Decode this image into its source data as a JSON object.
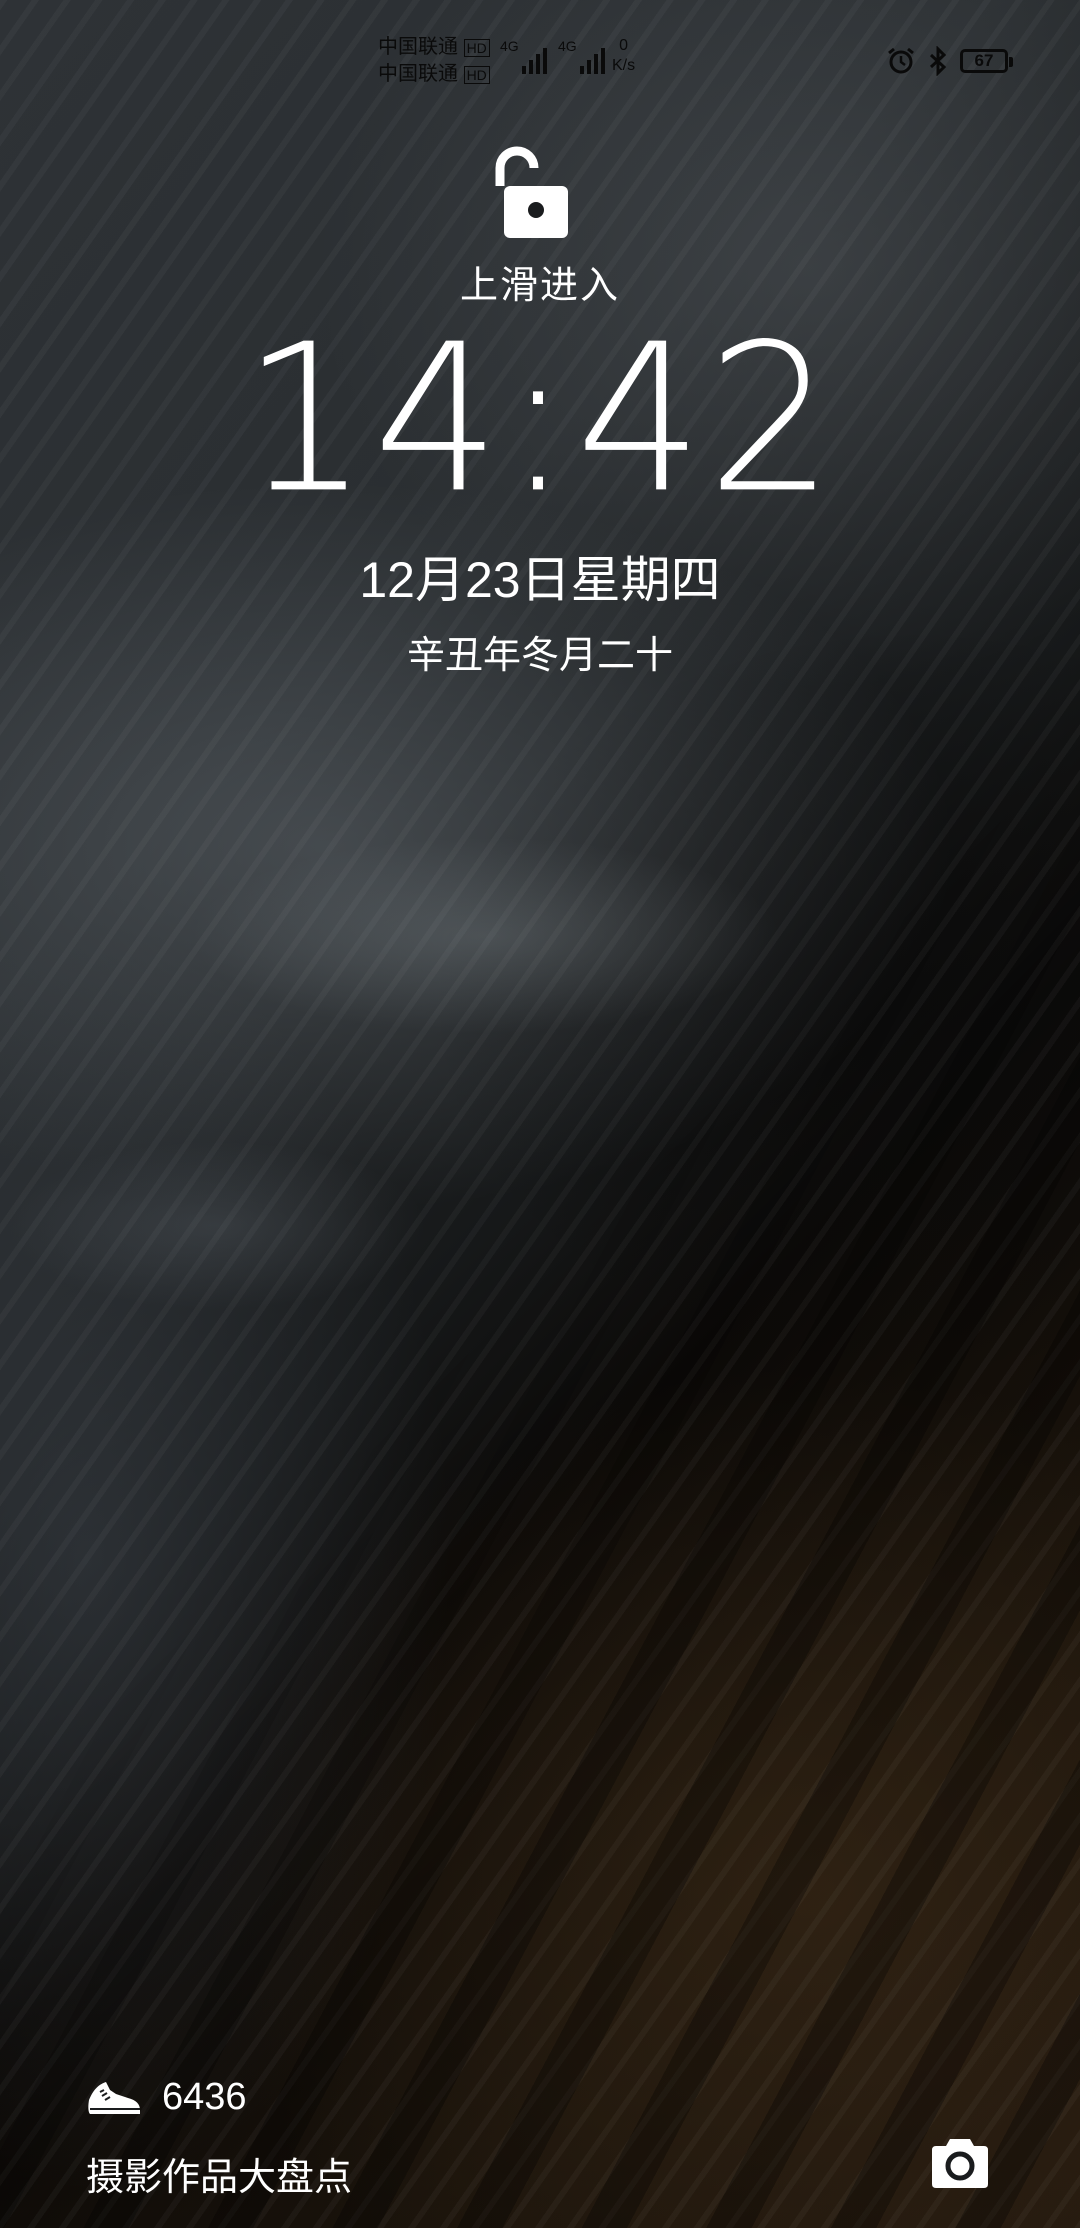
{
  "status_bar": {
    "carrier_line1": "中国联通",
    "carrier_badge1": "HD",
    "carrier_line2": "中国联通",
    "carrier_badge2": "HD",
    "network1": "4G",
    "network2": "4G",
    "speed_value": "0",
    "speed_unit": "K/s",
    "alarm_icon": "alarm-icon",
    "bluetooth_icon": "bluetooth-icon",
    "battery_level": "67"
  },
  "lock": {
    "icon": "unlock-icon",
    "hint": "上滑进入"
  },
  "clock": {
    "time": "14:42",
    "date": "12月23日星期四",
    "lunar": "辛丑年冬月二十"
  },
  "bottom": {
    "steps_icon": "shoe-icon",
    "steps": "6436",
    "magazine_title": "摄影作品大盘点",
    "camera_icon": "camera-icon"
  },
  "colors": {
    "text": "#ffffff",
    "status_text": "#0a0a0a"
  }
}
